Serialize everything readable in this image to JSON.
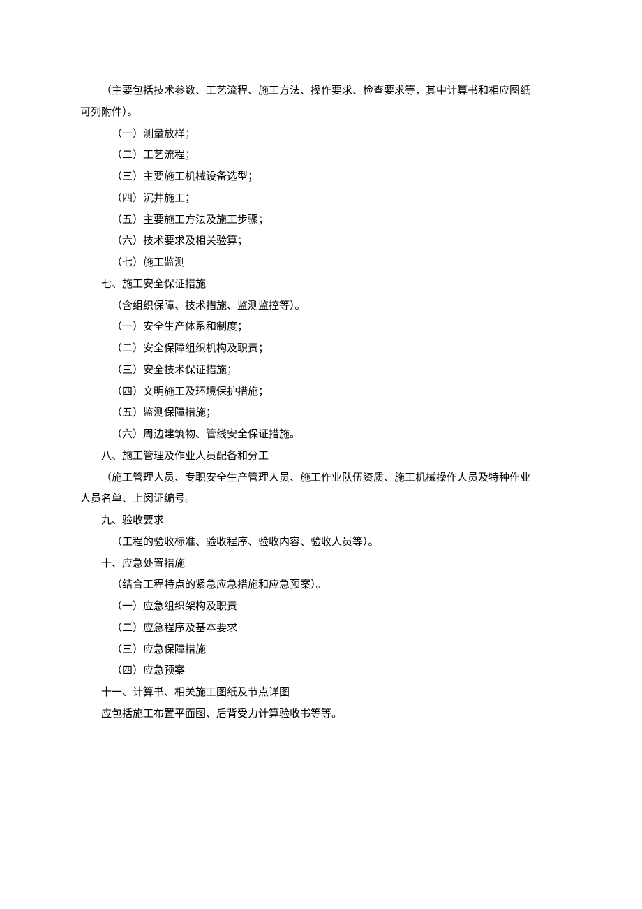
{
  "lines": {
    "l1": "（主要包括技术参数、工艺流程、施工方法、操作要求、检查要求等，其中计算书和相应图纸",
    "l2": "可列附件）。",
    "l3": "（一）测量放样；",
    "l4": "（二）工艺流程；",
    "l5": "（三）主要施工机械设备选型；",
    "l6": "（四）沉井施工；",
    "l7": "（五）主要施工方法及施工步骤；",
    "l8": "（六）技术要求及相关验算；",
    "l9": "（七）施工监测",
    "l10": "七、施工安全保证措施",
    "l11": "（含组织保障、技术措施、监测监控等）。",
    "l12": "（一）安全生产体系和制度；",
    "l13": "（二）安全保障组织机构及职责；",
    "l14": "（三）安全技术保证措施；",
    "l15": "（四）文明施工及环境保护措施；",
    "l16": "（五）监测保障措施；",
    "l17": "（六）周边建筑物、管线安全保证措施。",
    "l18": "八、施工管理及作业人员配备和分工",
    "l19": "（施工管理人员、专职安全生产管理人员、施工作业队伍资质、施工机械操作人员及特种作业",
    "l20": "人员名单、上闵证编号。",
    "l21": "九、验收要求",
    "l22": "（工程的验收标准、验收程序、验收内容、验收人员等）。",
    "l23": "十、应急处置措施",
    "l24": "（结合工程特点的紧急应急措施和应急预案）。",
    "l25": "（一）应急组织架构及职责",
    "l26": "（二）应急程序及基本要求",
    "l27": "（三）应急保障措施",
    "l28": "（四）应急预案",
    "l29": "十一、计算书、相关施工图纸及节点详图",
    "l30": "应包括施工布置平面图、后背受力计算验收书等等。"
  }
}
